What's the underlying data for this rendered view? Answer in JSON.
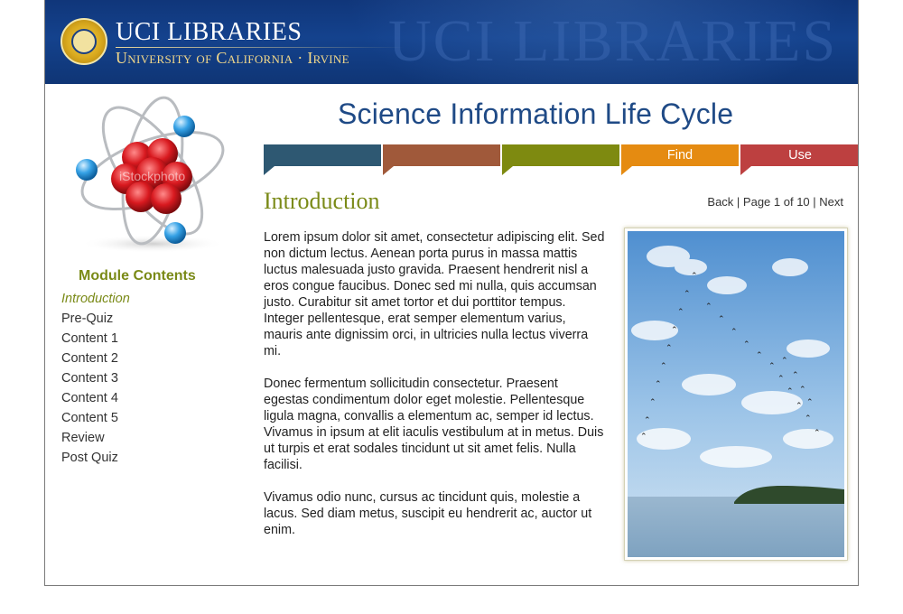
{
  "header": {
    "brand_title": "UCI LIBRARIES",
    "brand_subtitle": "University of California · Irvine",
    "watermark": "UCI LIBRARIES"
  },
  "atom_image": {
    "watermark": "iStockphoto"
  },
  "page_title": "Science Information Life Cycle",
  "tabs": [
    {
      "label": "",
      "color": "#2e5872"
    },
    {
      "label": "",
      "color": "#a0593a"
    },
    {
      "label": "",
      "color": "#7e8a10"
    },
    {
      "label": "Find",
      "color": "#e58b11"
    },
    {
      "label": "Use",
      "color": "#bd4040"
    }
  ],
  "sidebar": {
    "title": "Module Contents",
    "items": [
      {
        "label": "Introduction",
        "active": true
      },
      {
        "label": "Pre-Quiz"
      },
      {
        "label": "Content 1"
      },
      {
        "label": "Content 2"
      },
      {
        "label": "Content 3"
      },
      {
        "label": "Content 4"
      },
      {
        "label": "Content 5"
      },
      {
        "label": "Review"
      },
      {
        "label": "Post Quiz"
      }
    ]
  },
  "content": {
    "heading": "Introduction",
    "pager": {
      "back": "Back",
      "sep": " | ",
      "page": "Page 1 of 10",
      "next": "Next"
    },
    "paragraphs": [
      "Lorem ipsum dolor sit amet, consectetur adipiscing elit. Sed non dictum lectus. Aenean porta purus in massa mattis luctus malesuada justo gravida. Praesent hendrerit nisl a eros congue faucibus. Donec sed mi nulla, quis accumsan justo. Curabitur sit amet tortor et dui porttitor tempus. Integer pellentesque, erat semper elementum varius, mauris ante dignissim orci, in ultricies nulla lectus viverra mi.",
      "Donec fermentum sollicitudin consectetur. Praesent egestas condimentum dolor eget molestie. Pellentesque ligula magna, convallis a elementum ac, semper id lectus. Vivamus in ipsum at elit iaculis vestibulum at in metus. Duis ut turpis et erat sodales tincidunt ut sit amet felis. Nulla facilisi.",
      "Vivamus odio nunc, cursus ac tincidunt quis, molestie a lacus. Sed diam metus, suscipit eu hendrerit ac, auctor ut enim."
    ]
  },
  "colors": {
    "accent_green": "#7a8a17",
    "title_blue": "#1f4a86",
    "header_blue": "#14428d"
  }
}
